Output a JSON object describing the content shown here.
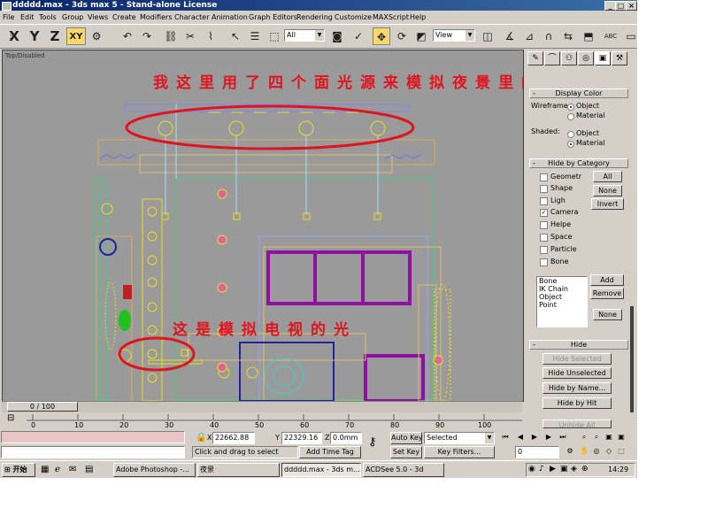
{
  "window": {
    "title": "ddddd.max - 3ds max 5 - Stand-alone License",
    "controls": [
      "_",
      "□",
      "×"
    ]
  },
  "menu": [
    "File",
    "Edit",
    "Tools",
    "Group",
    "Views",
    "Create",
    "Modifiers",
    "Character",
    "Animation",
    "Graph Editors",
    "Rendering",
    "Customize",
    "MAXScript",
    "Help"
  ],
  "toolbar": {
    "axis_x": "X",
    "axis_y": "Y",
    "axis_z": "Z",
    "axis_xy": "XY",
    "selection_filter": "All",
    "coord_system": "View",
    "abc_label": "ABC"
  },
  "viewport": {
    "label": "Top/Disabled",
    "annotation_top": "我这里用了四个面光源来模拟夜景里的蓝光",
    "annotation_tv": "这是模拟电视的光",
    "colors": {
      "annotation": "#e0141e",
      "background": "#9a9a9a",
      "lights": "#e8e020",
      "frame": "#9010a0"
    }
  },
  "command_panel": {
    "display_color": {
      "title": "Display Color",
      "wireframe_label": "Wireframe:",
      "wireframe_options": [
        "Object",
        "Material"
      ],
      "wireframe_selected": "Object",
      "shaded_label": "Shaded:",
      "shaded_options": [
        "Object",
        "Material"
      ],
      "shaded_selected": "Material"
    },
    "hide_by_category": {
      "title": "Hide by Category",
      "items": [
        {
          "label": "Geometr",
          "checked": false
        },
        {
          "label": "Shape",
          "checked": false
        },
        {
          "label": "Ligh",
          "checked": false
        },
        {
          "label": "Camera",
          "checked": true
        },
        {
          "label": "Helpe",
          "checked": false
        },
        {
          "label": "Space",
          "checked": false
        },
        {
          "label": "Particle",
          "checked": false
        },
        {
          "label": "Bone",
          "checked": false
        }
      ],
      "all_button": "All",
      "none_button": "None",
      "invert_button": "Invert",
      "list": [
        "Bone",
        "IK Chain Object",
        "Point"
      ],
      "add_button": "Add",
      "remove_button": "Remove",
      "none_button_2": "None"
    },
    "hide": {
      "title": "Hide",
      "hide_selected": "Hide Selected",
      "hide_unselected": "Hide Unselected",
      "hide_by_name": "Hide by Name...",
      "hide_by_hit": "Hide by Hit",
      "unhide_all": "Unhide All"
    }
  },
  "timeline": {
    "slider_text": "0 / 100",
    "ticks": [
      "0",
      "10",
      "20",
      "30",
      "40",
      "50",
      "60",
      "70",
      "80",
      "90",
      "100"
    ]
  },
  "status": {
    "x_label": "X",
    "x_value": "22662.88",
    "y_label": "Y",
    "y_value": "22329.16",
    "z_label": "Z",
    "z_value": "0.0mm",
    "prompt": "Click and drag to select",
    "add_time_tag": "Add Time Tag",
    "auto_key": "Auto Key",
    "set_key": "Set Key",
    "key_mode": "Selected",
    "key_filters": "Key Filters...",
    "frame": "0"
  },
  "taskbar": {
    "start": "开始",
    "tasks": [
      "Adobe Photoshop -...",
      "夜景",
      "ddddd.max - 3ds m...",
      "ACDSee 5.0 - 3d"
    ],
    "time": "14:29"
  }
}
